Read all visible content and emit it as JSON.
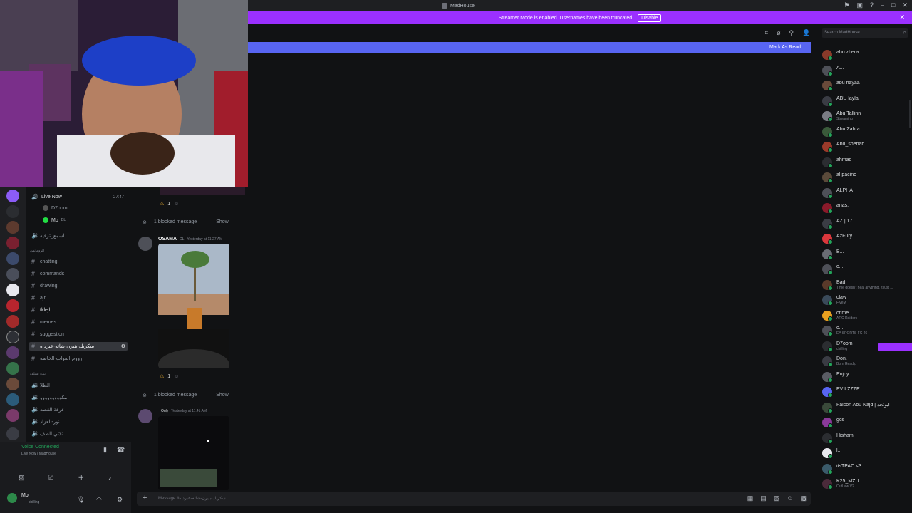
{
  "window": {
    "title": "MadHouse",
    "title_icons": [
      "inbox-icon",
      "monitor-icon",
      "help-icon",
      "minimize-icon",
      "maximize-icon",
      "close-icon"
    ]
  },
  "banner": {
    "text": "Streamer Mode is enabled. Usernames have been truncated.",
    "button": "Disable",
    "color": "#9b30ff"
  },
  "header": {
    "search_placeholder": "Search MadHouse"
  },
  "newbar": {
    "label": "Mark As Read",
    "color": "#5865f2"
  },
  "voice_channel": {
    "name": "Live Now",
    "timer": "27:47",
    "users": [
      "D7oom",
      "Mo"
    ],
    "user_tag": "DL"
  },
  "channels": {
    "top": "اسمع_ترفيه",
    "category1": "الرومانس",
    "list1": [
      {
        "name": "chatting"
      },
      {
        "name": "commands"
      },
      {
        "name": "drawing"
      },
      {
        "name": "ajr"
      },
      {
        "name": "tklejh"
      },
      {
        "name": "memes"
      },
      {
        "name": "suggestion"
      },
      {
        "name": "سكريك-بنيرن-شاته-عبرداه",
        "active": true
      },
      {
        "name": "زووم-الفوات-الخاصه"
      }
    ],
    "category2": "بيت نسلف",
    "list2": [
      "الطلا",
      "مكووووووووو",
      "غرفة القصه",
      "نور-العزاد",
      "ثلاثي الطف"
    ]
  },
  "voice_panel": {
    "status": "Voice Connected",
    "channel": "Live Now / MadHouse",
    "user": "Mo",
    "user_status": "chilling"
  },
  "messages": [
    {
      "type": "reaction",
      "count": "1"
    },
    {
      "type": "blocked",
      "text": "1 blocked message",
      "action": "Show"
    },
    {
      "type": "post",
      "author": "OSAMA",
      "tag": "DL",
      "time": "Yesterday at 11:27 AM",
      "reaction_count": "1"
    },
    {
      "type": "blocked",
      "text": "1 blocked message",
      "action": "Show"
    },
    {
      "type": "post",
      "author": "",
      "tag": "Only",
      "time": "Yesterday at 11:41 AM"
    }
  ],
  "composer": {
    "placeholder": "Message #سكريك-بنيرن-شاته-عبرداه"
  },
  "members": [
    {
      "name": "abo zhera",
      "status": ""
    },
    {
      "name": "A...",
      "status": ""
    },
    {
      "name": "abu hayaa",
      "status": ""
    },
    {
      "name": "ABU layla",
      "status": ""
    },
    {
      "name": "Abu Tallinn",
      "status": "Streaming"
    },
    {
      "name": "Abu Zahra",
      "status": ""
    },
    {
      "name": "Abu_shehab",
      "status": ""
    },
    {
      "name": "ahmad",
      "status": ""
    },
    {
      "name": "al pacino",
      "status": ""
    },
    {
      "name": "ALPHA",
      "status": ""
    },
    {
      "name": "anas.",
      "status": ""
    },
    {
      "name": "AZ | 17",
      "status": ""
    },
    {
      "name": "AzFury",
      "status": ""
    },
    {
      "name": "B...",
      "status": ""
    },
    {
      "name": "c...",
      "status": ""
    },
    {
      "name": "Badr",
      "status": "Time doesn't heal anything, it just ..."
    },
    {
      "name": "claw",
      "status": "FiveM"
    },
    {
      "name": "crime",
      "status": "ARC Raiders"
    },
    {
      "name": "c...",
      "status": "EA SPORTS FC 26"
    },
    {
      "name": "D7oom",
      "status": "chilling"
    },
    {
      "name": "Don.",
      "status": "Born Ready."
    },
    {
      "name": "Enjoy",
      "status": ""
    },
    {
      "name": "EVILZZZE",
      "status": ""
    },
    {
      "name": "Falcon Abu Najd | ابونجد",
      "status": ""
    },
    {
      "name": "gcs",
      "status": ""
    },
    {
      "name": "Hisham",
      "status": ""
    },
    {
      "name": "l...",
      "status": ""
    },
    {
      "name": "itsTPAC <3",
      "status": ""
    },
    {
      "name": "K25_MZU",
      "status": "OutLaw V2"
    }
  ]
}
